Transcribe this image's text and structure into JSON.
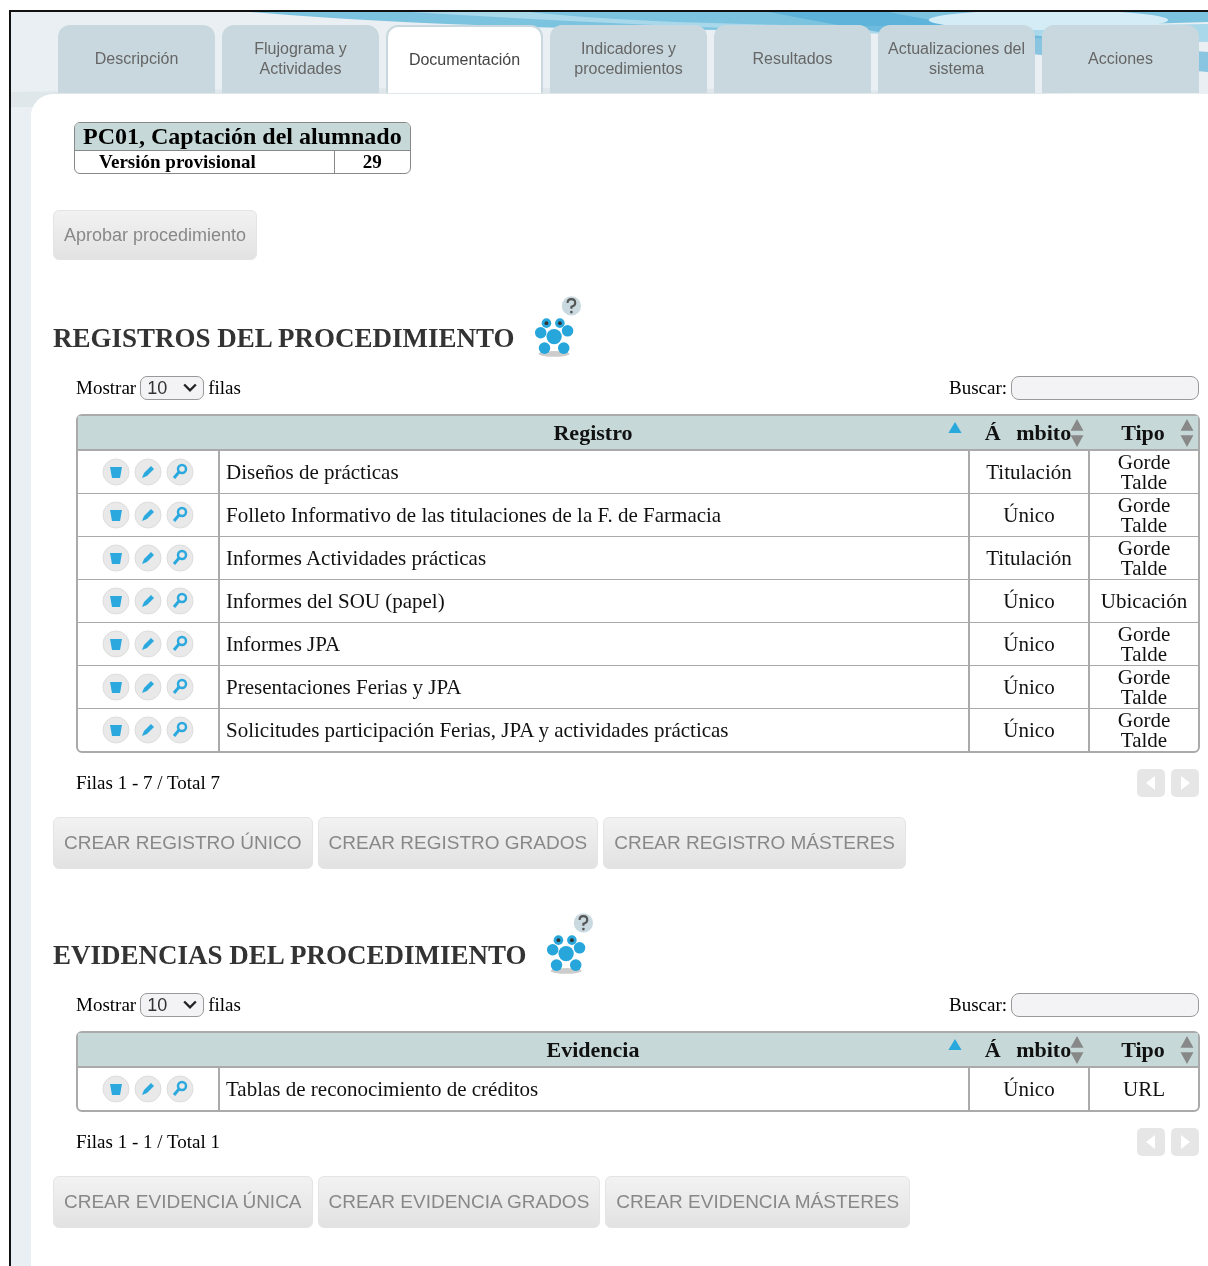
{
  "tabs": [
    {
      "label": "Descripción",
      "selected": false
    },
    {
      "label": "Flujograma y Actividades",
      "selected": false
    },
    {
      "label": "Documentación",
      "selected": true
    },
    {
      "label": "Indicadores y procedimientos",
      "selected": false
    },
    {
      "label": "Resultados",
      "selected": false
    },
    {
      "label": "Actualizaciones del sistema",
      "selected": false
    },
    {
      "label": "Acciones",
      "selected": false
    }
  ],
  "procedure": {
    "title": "PC01, Captación del alumnado",
    "version_label": "Versión provisional",
    "version_number": "29"
  },
  "approve_button": "Aprobar procedimiento",
  "sections": [
    {
      "title": "REGISTROS DEL PROCEDIMIENTO",
      "show_label": "Mostrar",
      "page_size": "10",
      "rows_label": "filas",
      "search_label": "Buscar:",
      "columns": [
        {
          "label": "Registro",
          "sorted": true
        },
        {
          "label": "Á mbito",
          "sorted": false
        },
        {
          "label": "Tipo",
          "sorted": false
        }
      ],
      "rows": [
        {
          "name": "Diseños de prácticas",
          "scope": "Titulación",
          "type": "Gorde Talde"
        },
        {
          "name": "Folleto Informativo de las titulaciones de la F. de Farmacia",
          "scope": "Único",
          "type": "Gorde Talde"
        },
        {
          "name": "Informes Actividades prácticas",
          "scope": "Titulación",
          "type": "Gorde Talde"
        },
        {
          "name": "Informes del SOU (papel)",
          "scope": "Único",
          "type": "Ubicación"
        },
        {
          "name": "Informes JPA",
          "scope": "Único",
          "type": "Gorde Talde"
        },
        {
          "name": "Presentaciones Ferias y JPA",
          "scope": "Único",
          "type": "Gorde Talde"
        },
        {
          "name": "Solicitudes participación Ferias, JPA y actividades prácticas",
          "scope": "Único",
          "type": "Gorde Talde"
        }
      ],
      "footer": "Filas 1 - 7 / Total 7",
      "prev_disabled": true,
      "next_disabled": true,
      "buttons": [
        "CREAR REGISTRO ÚNICO",
        "CREAR REGISTRO GRADOS",
        "CREAR REGISTRO MÁSTERES"
      ]
    },
    {
      "title": "EVIDENCIAS DEL PROCEDIMIENTO",
      "show_label": "Mostrar",
      "page_size": "10",
      "rows_label": "filas",
      "search_label": "Buscar:",
      "columns": [
        {
          "label": "Evidencia",
          "sorted": true
        },
        {
          "label": "Á mbito",
          "sorted": false
        },
        {
          "label": "Tipo",
          "sorted": false
        }
      ],
      "rows": [
        {
          "name": "Tablas de reconocimiento de créditos",
          "scope": "Único",
          "type": "URL"
        }
      ],
      "footer": "Filas 1 - 1 / Total 1",
      "prev_disabled": true,
      "next_disabled": true,
      "buttons": [
        "CREAR EVIDENCIA ÚNICA",
        "CREAR EVIDENCIA GRADOS",
        "CREAR EVIDENCIA MÁSTERES"
      ]
    }
  ]
}
